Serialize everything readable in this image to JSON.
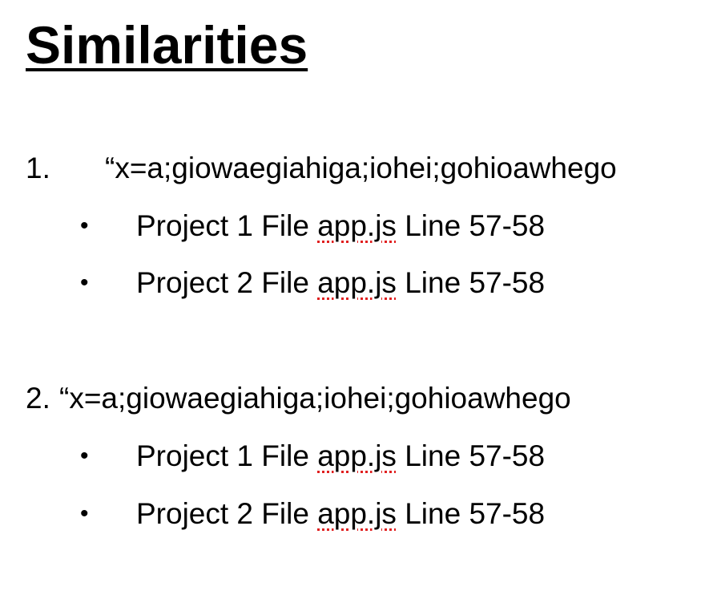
{
  "title": "Similarities",
  "items": [
    {
      "number": "1.",
      "quote": "“x=a;giowaegiahiga;iohei;gohioawhego",
      "subitems": [
        {
          "bullet": "•",
          "prefix": "Project 1 File ",
          "file": "app.js",
          "suffix": " Line 57-58"
        },
        {
          "bullet": "•",
          "prefix": "Project 2 File ",
          "file": "app.js",
          "suffix": " Line 57-58"
        }
      ]
    },
    {
      "number": "2.",
      "quote": "“x=a;giowaegiahiga;iohei;gohioawhego",
      "subitems": [
        {
          "bullet": "•",
          "prefix": "Project 1 File ",
          "file": "app.js",
          "suffix": " Line 57-58"
        },
        {
          "bullet": "•",
          "prefix": "Project 2 File ",
          "file": "app.js",
          "suffix": " Line 57-58"
        }
      ]
    }
  ],
  "colors": {
    "text": "#000000",
    "spellcheck_underline": "#e02020",
    "background": "#ffffff"
  }
}
